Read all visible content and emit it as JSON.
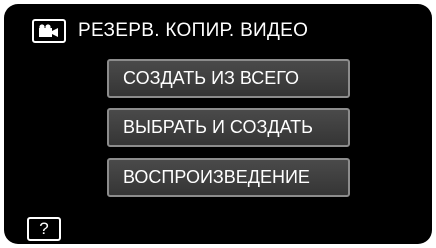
{
  "header": {
    "icon": "video-camera-icon",
    "title": "РЕЗЕРВ. КОПИР. ВИДЕО"
  },
  "menu": {
    "items": [
      {
        "label": "СОЗДАТЬ ИЗ ВСЕГО"
      },
      {
        "label": "ВЫБРАТЬ И СОЗДАТЬ"
      },
      {
        "label": "ВОСПРОИЗВЕДЕНИЕ"
      }
    ]
  },
  "help": {
    "label": "?",
    "icon": "help-icon"
  },
  "colors": {
    "background": "#000000",
    "text": "#ffffff",
    "button_border": "#8c8c8c",
    "button_fill": "#404040"
  }
}
